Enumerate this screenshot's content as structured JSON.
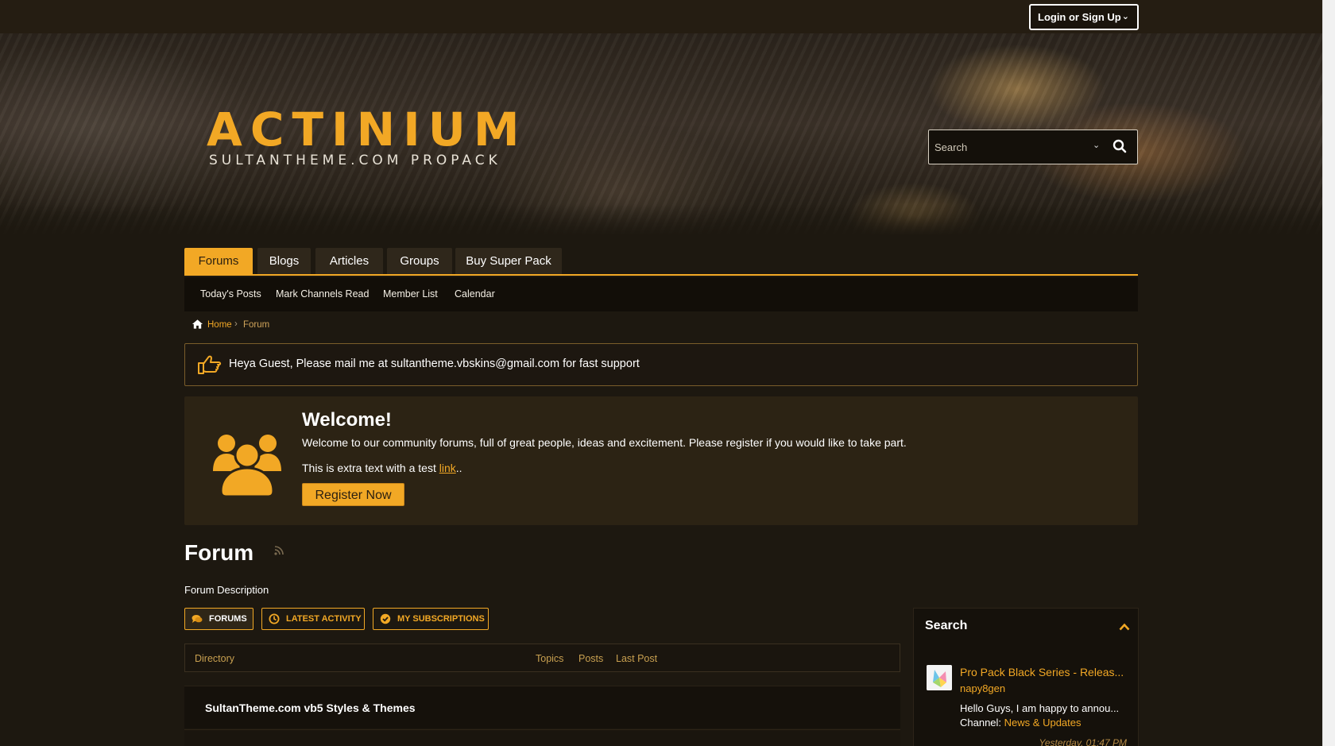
{
  "topbar": {
    "login_label": "Login or Sign Up"
  },
  "header": {
    "logo_title": "ACTINIUM",
    "logo_subtitle": "SULTANTHEME.COM PROPACK",
    "search_placeholder": "Search"
  },
  "nav": {
    "tabs": [
      {
        "label": "Forums",
        "active": true
      },
      {
        "label": "Blogs"
      },
      {
        "label": "Articles"
      },
      {
        "label": "Groups"
      },
      {
        "label": "Buy Super Pack"
      }
    ],
    "sub": [
      "Today's Posts",
      "Mark Channels Read",
      "Member List",
      "Calendar"
    ]
  },
  "breadcrumb": {
    "home": "Home",
    "current": "Forum"
  },
  "notice": {
    "text": "Heya Guest, Please mail me at sultantheme.vbskins@gmail.com for fast support"
  },
  "welcome": {
    "title": "Welcome!",
    "text": "Welcome to our community forums, full of great people, ideas and excitement. Please register if you would like to take part.",
    "extra_prefix": "This is extra text with a test ",
    "extra_link": "link",
    "extra_suffix": "..",
    "register_label": "Register Now"
  },
  "forum": {
    "title": "Forum",
    "description": "Forum Description",
    "buttons": [
      {
        "label": "FORUMS",
        "active": true
      },
      {
        "label": "LATEST ACTIVITY"
      },
      {
        "label": "MY SUBSCRIPTIONS"
      }
    ],
    "columns": {
      "directory": "Directory",
      "topics": "Topics",
      "posts": "Posts",
      "last_post": "Last Post"
    },
    "category": "SultanTheme.com vb5 Styles & Themes"
  },
  "sidebar_search": {
    "title": "Search",
    "post": {
      "title": "Pro Pack Black Series - Releas...",
      "user": "napy8gen",
      "body": "Hello Guys, I am happy to annou...",
      "channel_label": "Channel:",
      "channel": "News & Updates",
      "time": "Yesterday, 01:47 PM"
    }
  },
  "colors": {
    "accent": "#f2a825",
    "background": "#1d1810",
    "panel": "#2c2314"
  }
}
